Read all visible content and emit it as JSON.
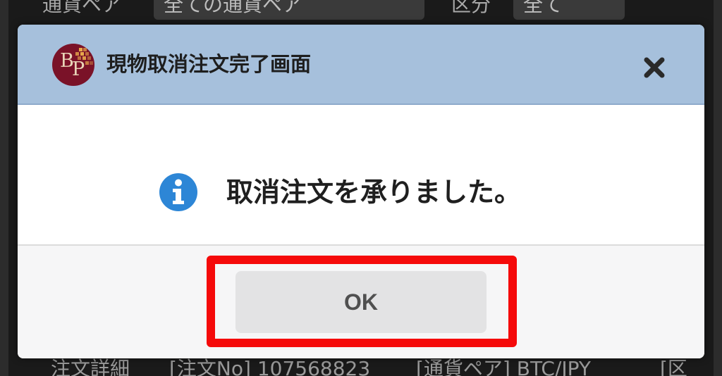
{
  "background": {
    "top_fields": [
      "通貨ペア",
      "全ての通貨ペア",
      "区分",
      "全て"
    ],
    "bottom_text": [
      "注文詳細",
      "[注文No] 107568823",
      "[通貨ペア] BTC/JPY",
      "[区"
    ]
  },
  "dialog": {
    "title": "現物取消注文完了画面",
    "logo_letters": [
      "B",
      "P"
    ],
    "close_icon": "close-icon",
    "message": "取消注文を承りました。",
    "message_icon": "info-icon",
    "ok_label": "OK",
    "colors": {
      "header_bg": "#a6c0dc",
      "info_icon": "#2d86d6",
      "highlight": "#f50a0a",
      "logo_bg": "#7a1228"
    }
  }
}
